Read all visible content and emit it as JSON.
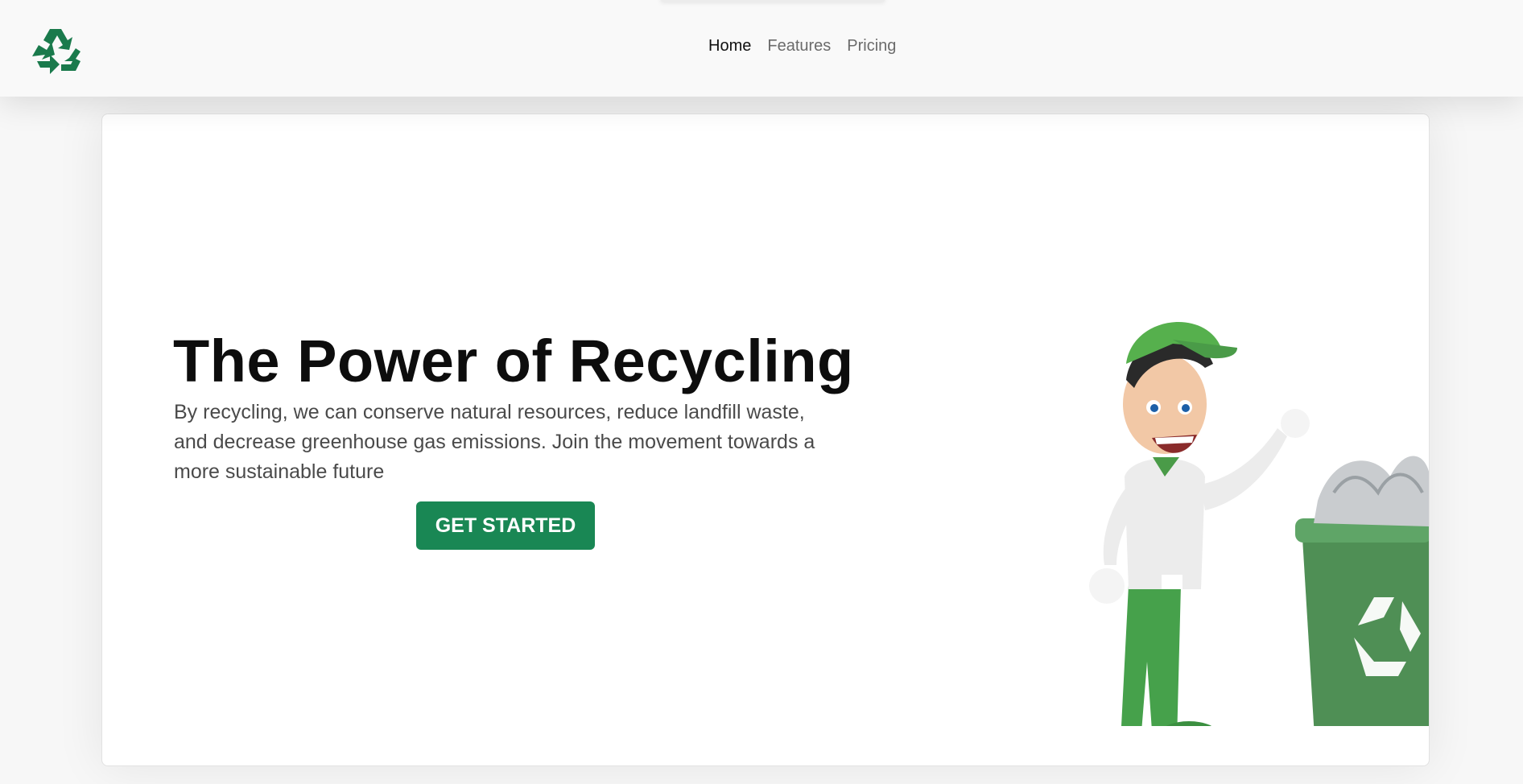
{
  "header": {
    "logo_icon": "recycle-icon",
    "nav": [
      {
        "label": "Home",
        "active": true
      },
      {
        "label": "Features",
        "active": false
      },
      {
        "label": "Pricing",
        "active": false
      }
    ]
  },
  "hero": {
    "title": "The Power of Recycling",
    "description": "By recycling, we can conserve natural resources, reduce landfill waste, and decrease greenhouse gas emissions. Join the movement towards a more sustainable future",
    "cta_label": "GET STARTED",
    "illustration": "recycling-mascot-with-bin"
  },
  "colors": {
    "brand_green": "#198754",
    "logo_green": "#1a7a4c",
    "text_dark": "#0d0d0d",
    "text_muted": "#4a4a4a",
    "nav_inactive": "#6b6b6b"
  }
}
